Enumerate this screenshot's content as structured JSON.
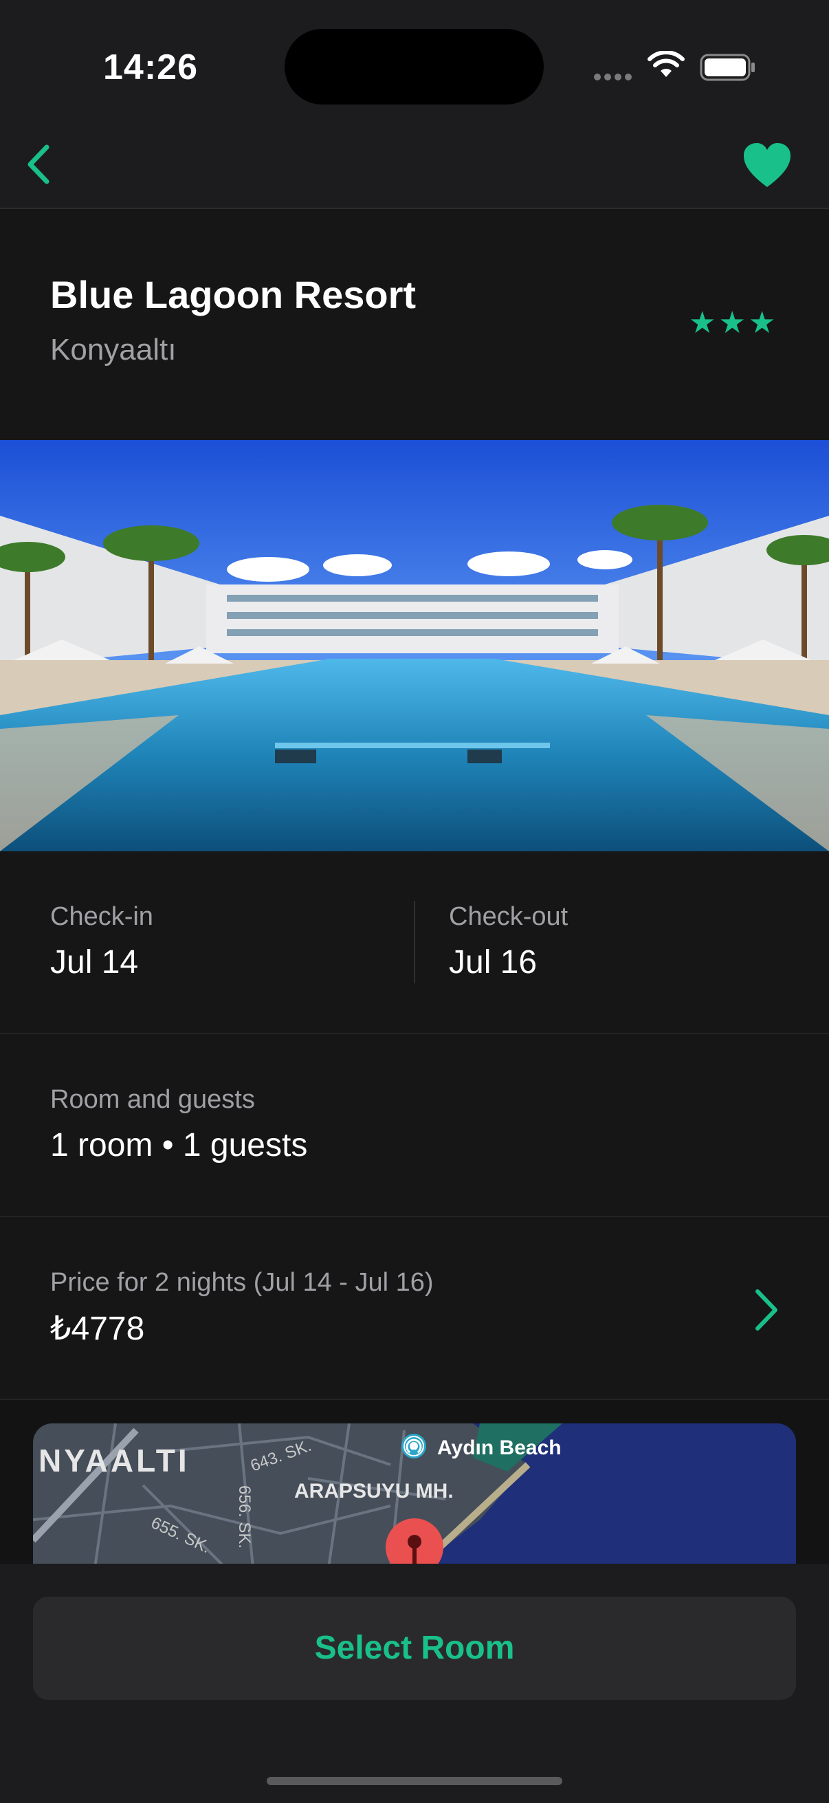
{
  "status": {
    "time": "14:26"
  },
  "colors": {
    "accent": "#19c08a",
    "background": "#131314",
    "surface": "#161617"
  },
  "nav": {
    "back_icon": "chevron-left-icon",
    "favorite_icon": "heart-icon"
  },
  "hotel": {
    "name": "Blue Lagoon Resort",
    "location": "Konyaaltı",
    "stars": "★★★",
    "star_count": 3
  },
  "dates": {
    "checkin_label": "Check-in",
    "checkin_value": "Jul 14",
    "checkout_label": "Check-out",
    "checkout_value": "Jul 16"
  },
  "guests": {
    "label": "Room and guests",
    "value": "1 room • 1 guests"
  },
  "price": {
    "label": "Price for 2 nights (Jul 14 - Jul 16)",
    "value": "₺4778"
  },
  "map": {
    "district": "NYAALTI",
    "neighborhood": "ARAPSUYU MH.",
    "street_1": "643. SK.",
    "street_2": "655. SK.",
    "street_3": "656. SK.",
    "poi": "Aydın Beach"
  },
  "cta": {
    "select_room": "Select Room"
  }
}
